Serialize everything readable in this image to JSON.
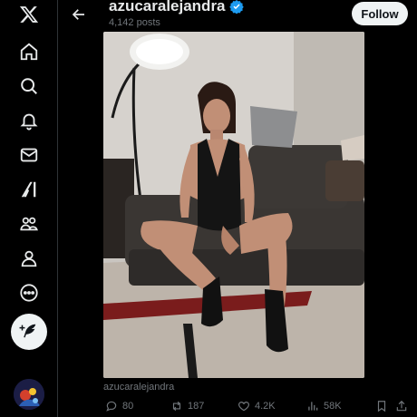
{
  "rail": {
    "items": [
      {
        "name": "x-logo"
      },
      {
        "name": "home"
      },
      {
        "name": "explore"
      },
      {
        "name": "notifications"
      },
      {
        "name": "messages"
      },
      {
        "name": "grok"
      },
      {
        "name": "communities"
      },
      {
        "name": "profile"
      },
      {
        "name": "more"
      }
    ],
    "post_button": "compose-post",
    "account_avatar": "account-avatar"
  },
  "header": {
    "author_name": "azucaralejandra",
    "post_count": "4,142 posts",
    "follow_label": "Follow"
  },
  "media": {
    "username_caption": "azucaralejandra"
  },
  "actions": {
    "replies": "80",
    "reposts": "187",
    "likes": "4.2K",
    "views": "58K"
  },
  "colors": {
    "background": "#000000",
    "text_primary": "#e7e9ea",
    "text_secondary": "#71767b",
    "verified": "#1d9bf0",
    "button_light": "#eff3f4"
  }
}
